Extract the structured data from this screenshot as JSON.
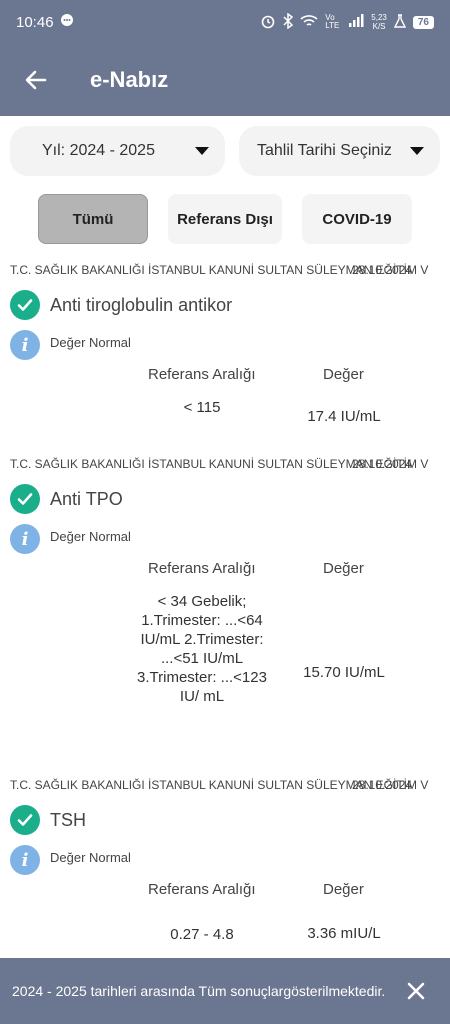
{
  "status_bar": {
    "time": "10:46",
    "network_speed_value": "5,23",
    "network_speed_unit": "K/S",
    "lte_label": "Vo LTE",
    "battery": "76"
  },
  "header": {
    "title": "e-Nabız",
    "back_icon": "arrow-left-icon"
  },
  "filters": {
    "year_select": "Yıl: 2024 - 2025",
    "date_select": "Tahlil Tarihi Seçiniz"
  },
  "tabs": [
    {
      "label": "Tümü",
      "active": true
    },
    {
      "label": "Referans Dışı",
      "active": false
    },
    {
      "label": "COVID-19",
      "active": false
    }
  ],
  "results": [
    {
      "institution": "T.C. SAĞLIK BAKANLIĞI İSTANBUL KANUNİ SULTAN SÜLEYMAN EĞİTİM V",
      "date": "28.10.2024",
      "test_name": "Anti tiroglobulin antikor",
      "status": "Değer Normal",
      "ref_header": "Referans Aralığı",
      "value_header": "Değer",
      "reference": "< 115",
      "value": "17.4 IU/mL"
    },
    {
      "institution": "T.C. SAĞLIK BAKANLIĞI İSTANBUL KANUNİ SULTAN SÜLEYMAN EĞİTİM V",
      "date": "28.10.2024",
      "test_name": "Anti TPO",
      "status": "Değer Normal",
      "ref_header": "Referans Aralığı",
      "value_header": "Değer",
      "reference": "< 34 Gebelik; 1.Trimester: ...<64 IU/mL 2.Trimester: ...<51 IU/mL 3.Trimester: ...<123 IU/ mL",
      "value": "15.70 IU/mL"
    },
    {
      "institution": "T.C. SAĞLIK BAKANLIĞI İSTANBUL KANUNİ SULTAN SÜLEYMAN EĞİTİM V",
      "date": "28.10.2024",
      "test_name": "TSH",
      "status": "Değer Normal",
      "ref_header": "Referans Aralığı",
      "value_header": "Değer",
      "reference": "0.27 - 4.8",
      "value": "3.36 mIU/L"
    }
  ],
  "snackbar": {
    "message": "2024 - 2025 tarihleri arasında Tüm sonuçlargösterilmektedir."
  },
  "colors": {
    "header": "#6b7690",
    "check": "#1aae8b",
    "info": "#7fb3e6",
    "active_tab": "#b4b4b4"
  }
}
